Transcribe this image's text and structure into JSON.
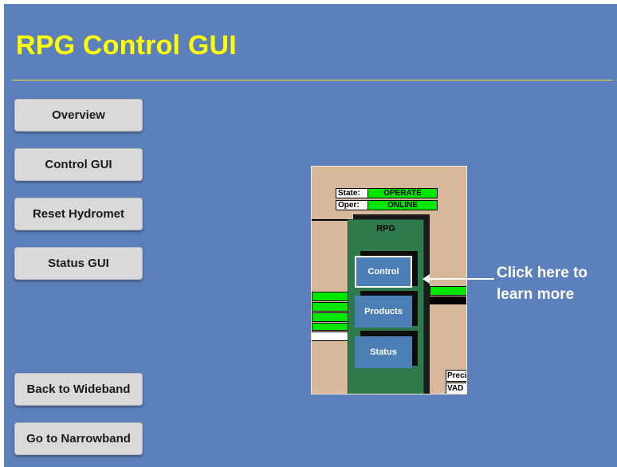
{
  "header": {
    "title": "RPG Control GUI"
  },
  "nav": {
    "overview": "Overview",
    "control_gui": "Control GUI",
    "reset_hydromet": "Reset Hydromet",
    "status_gui": "Status GUI",
    "back_wideband": "Back to Wideband",
    "go_narrowband": "Go to Narrowband"
  },
  "diagram": {
    "state_label": "State:",
    "state_value": "OPERATE",
    "oper_label": "Oper:",
    "oper_value": "ONLINE",
    "rpg_label": "RPG",
    "control_label": "Control",
    "products_label": "Products",
    "status_label": "Status",
    "side_label_1": "Preci",
    "side_label_2": "VAD"
  },
  "callout": {
    "line1": "Click here to",
    "line2": "learn more"
  },
  "colors": {
    "background": "#5b80bb",
    "title": "#ffff00",
    "status_green": "#00e600"
  }
}
